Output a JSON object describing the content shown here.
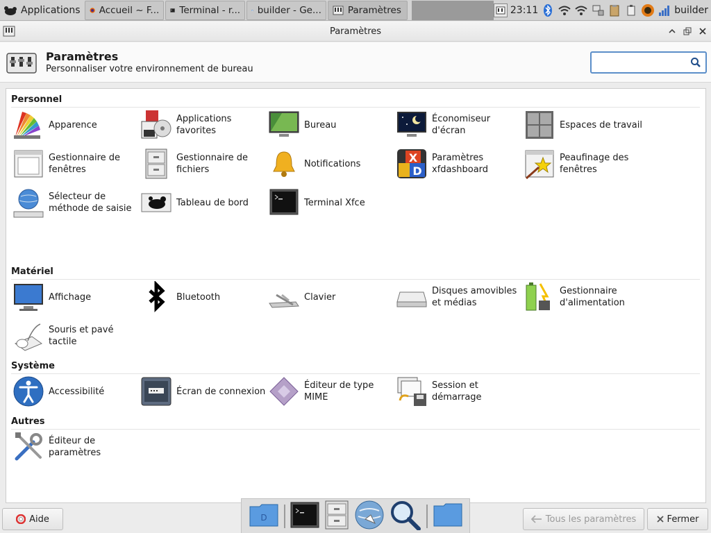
{
  "panel": {
    "apps_label": "Applications",
    "tasks": [
      {
        "label": "Accueil ~ F..."
      },
      {
        "label": "Terminal - r..."
      },
      {
        "label": "builder - Ge..."
      },
      {
        "label": "Paramètres"
      }
    ],
    "clock": "23:11",
    "user": "builder"
  },
  "window": {
    "title": "Paramètres"
  },
  "header": {
    "title": "Paramètres",
    "subtitle": "Personnaliser votre environnement de bureau",
    "search_value": ""
  },
  "categories": {
    "personnel": {
      "title": "Personnel",
      "items": [
        {
          "label": "Apparence"
        },
        {
          "label": "Applications favorites"
        },
        {
          "label": "Bureau"
        },
        {
          "label": "Économiseur d'écran"
        },
        {
          "label": "Espaces de travail"
        },
        {
          "label": "Gestionnaire de fenêtres"
        },
        {
          "label": "Gestionnaire de fichiers"
        },
        {
          "label": "Notifications"
        },
        {
          "label": "Paramètres xfdashboard"
        },
        {
          "label": "Peaufinage des fenêtres"
        },
        {
          "label": "Sélecteur de méthode de saisie"
        },
        {
          "label": "Tableau de bord"
        },
        {
          "label": "Terminal Xfce"
        }
      ]
    },
    "materiel": {
      "title": "Matériel",
      "items": [
        {
          "label": "Affichage"
        },
        {
          "label": "Bluetooth"
        },
        {
          "label": "Clavier"
        },
        {
          "label": "Disques amovibles et médias"
        },
        {
          "label": "Gestionnaire d'alimentation"
        },
        {
          "label": "Souris et pavé tactile"
        }
      ]
    },
    "systeme": {
      "title": "Système",
      "items": [
        {
          "label": "Accessibilité"
        },
        {
          "label": "Écran de connexion"
        },
        {
          "label": "Éditeur de type MIME"
        },
        {
          "label": "Session et démarrage"
        }
      ]
    },
    "autres": {
      "title": "Autres",
      "items": [
        {
          "label": "Éditeur de paramètres"
        }
      ]
    }
  },
  "buttons": {
    "help": "Aide",
    "all_settings": "Tous les paramètres",
    "close": "Fermer"
  },
  "colors": {
    "accent": "#5b8ec9",
    "content_bg": "#ffffff"
  }
}
